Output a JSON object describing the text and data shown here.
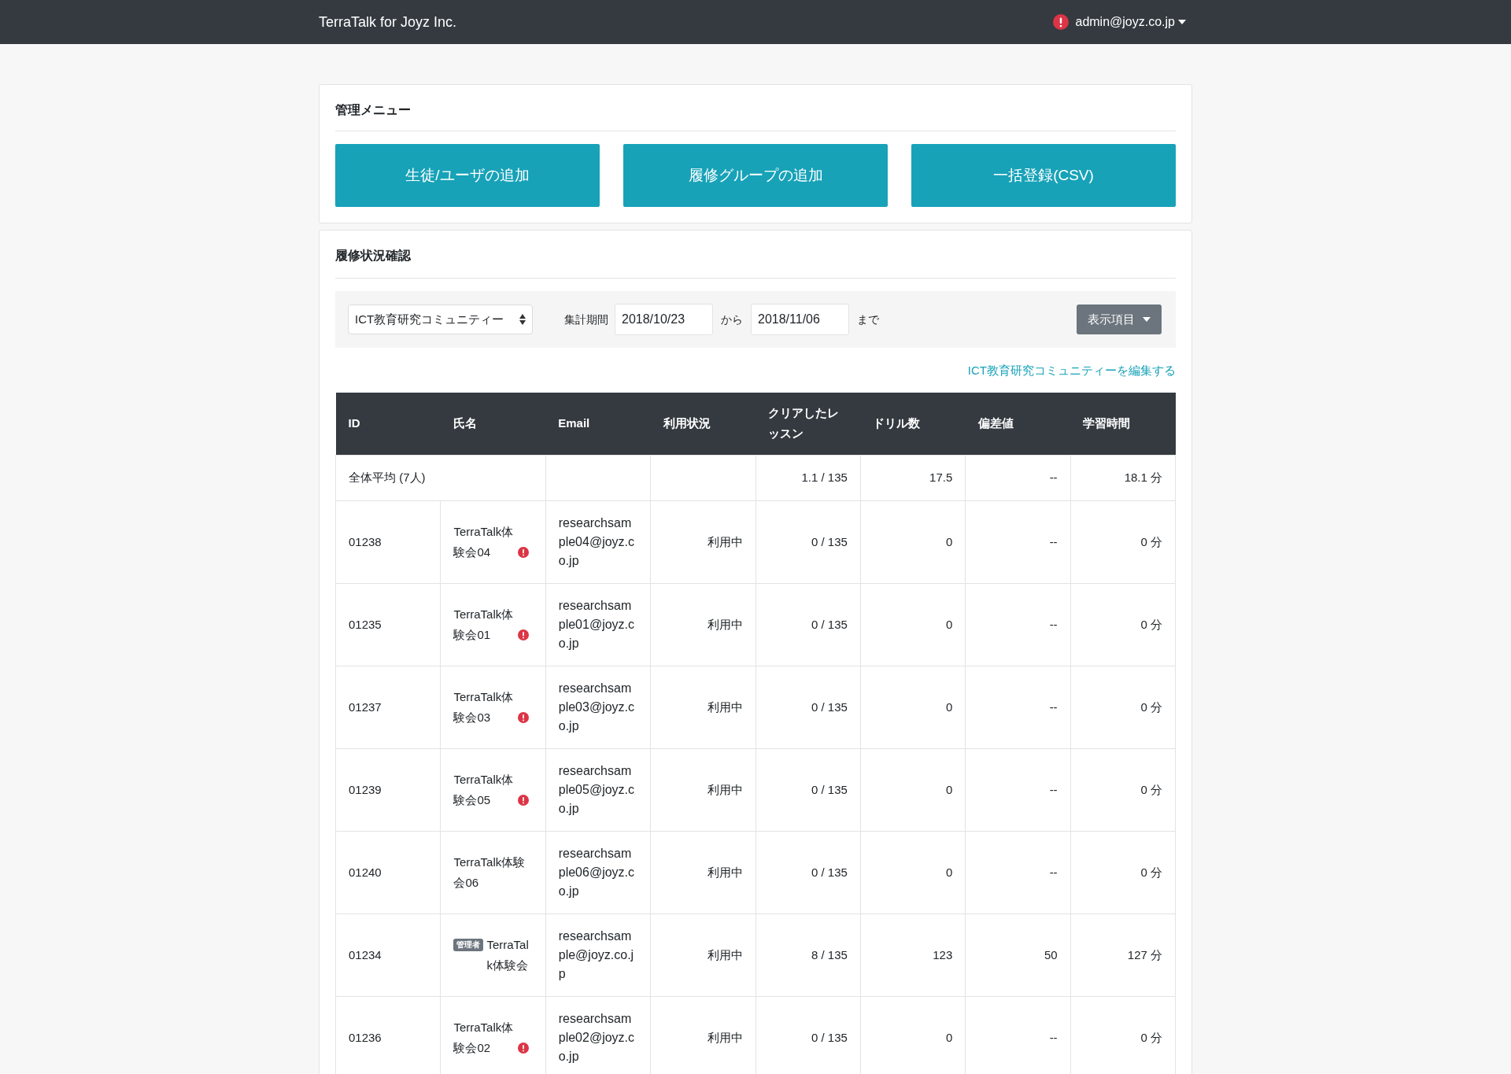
{
  "navbar": {
    "brand": "TerraTalk for Joyz Inc.",
    "user_email": "admin@joyz.co.jp",
    "user_warning": true
  },
  "admin_menu": {
    "title": "管理メニュー",
    "buttons": [
      "生徒/ユーザの追加",
      "履修グループの追加",
      "一括登録(CSV)"
    ]
  },
  "progress": {
    "title": "履修状況確認",
    "filter": {
      "group_select": "ICT教育研究コミュニティー",
      "period_label": "集計期間",
      "date_from": "2018/10/23",
      "from_suffix": "から",
      "date_to": "2018/11/06",
      "to_suffix": "まで",
      "columns_button": "表示項目"
    },
    "edit_link": "ICT教育研究コミュニティーを編集する",
    "table": {
      "columns": [
        "ID",
        "氏名",
        "Email",
        "利用状況",
        "クリアしたレッスン",
        "ドリル数",
        "偏差値",
        "学習時間"
      ],
      "summary": {
        "label": "全体平均 (7人)",
        "lessons": "1.1 / 135",
        "drills": "17.5",
        "deviation": "--",
        "study_time": "18.1 分"
      },
      "rows": [
        {
          "id": "01238",
          "name": "TerraTalk体験会04",
          "admin": false,
          "warning": true,
          "email": "researchsample04@joyz.co.jp",
          "status": "利用中",
          "lessons": "0 / 135",
          "drills": "0",
          "deviation": "--",
          "study_time": "0 分"
        },
        {
          "id": "01235",
          "name": "TerraTalk体験会01",
          "admin": false,
          "warning": true,
          "email": "researchsample01@joyz.co.jp",
          "status": "利用中",
          "lessons": "0 / 135",
          "drills": "0",
          "deviation": "--",
          "study_time": "0 分"
        },
        {
          "id": "01237",
          "name": "TerraTalk体験会03",
          "admin": false,
          "warning": true,
          "email": "researchsample03@joyz.co.jp",
          "status": "利用中",
          "lessons": "0 / 135",
          "drills": "0",
          "deviation": "--",
          "study_time": "0 分"
        },
        {
          "id": "01239",
          "name": "TerraTalk体験会05",
          "admin": false,
          "warning": true,
          "email": "researchsample05@joyz.co.jp",
          "status": "利用中",
          "lessons": "0 / 135",
          "drills": "0",
          "deviation": "--",
          "study_time": "0 分"
        },
        {
          "id": "01240",
          "name": "TerraTalk体験会06",
          "admin": false,
          "warning": false,
          "email": "researchsample06@joyz.co.jp",
          "status": "利用中",
          "lessons": "0 / 135",
          "drills": "0",
          "deviation": "--",
          "study_time": "0 分"
        },
        {
          "id": "01234",
          "name": "TerraTalk体験会",
          "admin": true,
          "admin_badge": "管理者",
          "warning": false,
          "email": "researchsample@joyz.co.jp",
          "status": "利用中",
          "lessons": "8 / 135",
          "drills": "123",
          "deviation": "50",
          "study_time": "127 分"
        },
        {
          "id": "01236",
          "name": "TerraTalk体験会02",
          "admin": false,
          "warning": true,
          "email": "researchsample02@joyz.co.jp",
          "status": "利用中",
          "lessons": "0 / 135",
          "drills": "0",
          "deviation": "--",
          "study_time": "0 分"
        }
      ]
    }
  }
}
